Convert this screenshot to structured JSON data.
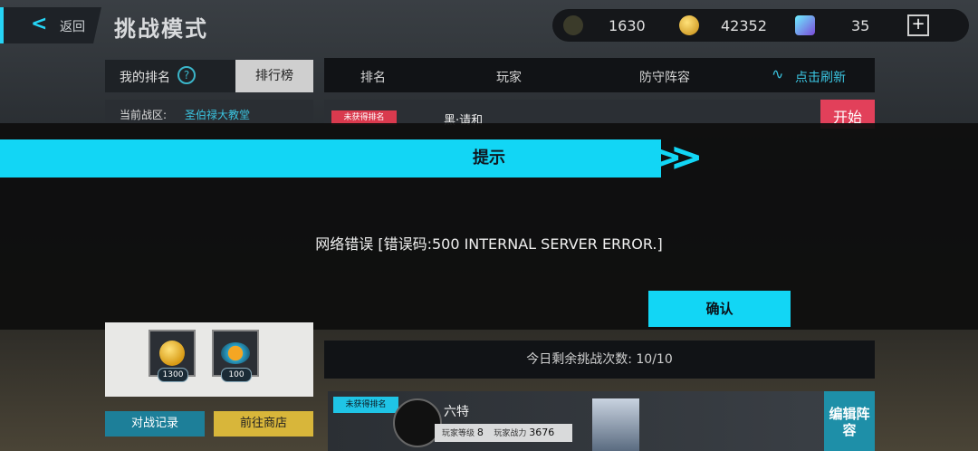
{
  "header": {
    "back_label": "返回",
    "title": "挑战模式"
  },
  "currency": {
    "c1": "1630",
    "c2": "42352",
    "c3": "35"
  },
  "left_panel": {
    "tab_my_rank": "我的排名",
    "tab_leaderboard": "排行榜",
    "zone_key": "当前战区:",
    "zone_value": "圣伯禄大教堂"
  },
  "table": {
    "col_rank": "排名",
    "col_player": "玩家",
    "col_defense": "防守阵容",
    "refresh": "点击刷新"
  },
  "row1": {
    "badge": "未获得排名",
    "name": "黑·请和",
    "start": "开始"
  },
  "dialog": {
    "title": "提示",
    "message": "网络错误 [错误码:500 INTERNAL SERVER ERROR.]",
    "confirm": "确认"
  },
  "rewards": [
    {
      "count": "1300"
    },
    {
      "count": "100"
    }
  ],
  "remaining": "今日剩余挑战次数: 10/10",
  "buttons": {
    "history": "对战记录",
    "shop": "前往商店"
  },
  "my_row": {
    "badge": "未获得排名",
    "name": "六特",
    "level_label": "玩家等级",
    "level": "8",
    "power_label": "玩家战力",
    "power": "3676",
    "edit": "编辑阵容"
  }
}
